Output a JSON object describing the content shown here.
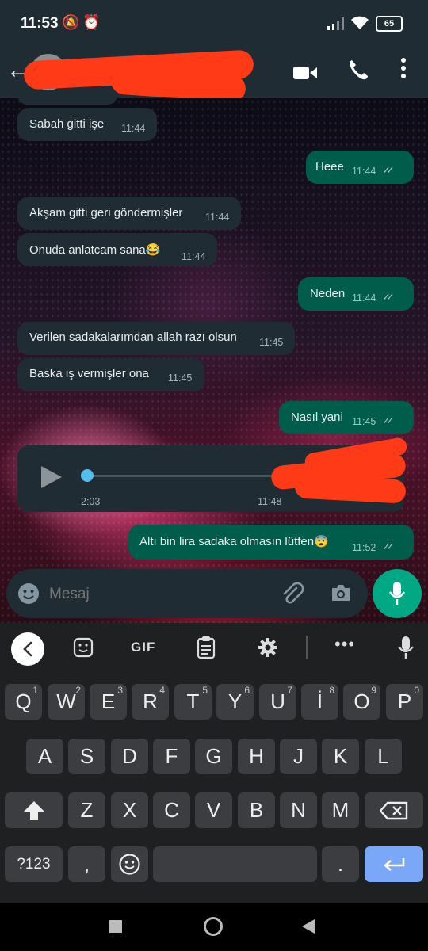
{
  "status_bar": {
    "time": "11:53",
    "battery": "65"
  },
  "header": {
    "contact_name": ""
  },
  "messages": [
    {
      "dir": "in",
      "text": "Sabah gitti işe",
      "time": "11:44"
    },
    {
      "dir": "out",
      "text": "Heee",
      "time": "11:44"
    },
    {
      "dir": "in",
      "text": "Akşam gitti geri göndermişler",
      "time": "11:44"
    },
    {
      "dir": "in",
      "text": "Onuda anlatcam sana😂",
      "time": "11:44"
    },
    {
      "dir": "out",
      "text": "Neden",
      "time": "11:44"
    },
    {
      "dir": "in",
      "text": "Verilen sadakalarımdan allah razı olsun",
      "time": "11:45"
    },
    {
      "dir": "in",
      "text": "Baska iş vermişler ona",
      "time": "11:45"
    },
    {
      "dir": "out",
      "text": "Nasıl yani",
      "time": "11:45"
    },
    {
      "dir": "out",
      "text": "Altı bin lira sadaka olmasın lütfen😨",
      "time": "11:52"
    }
  ],
  "voice_note": {
    "duration": "2:03",
    "time": "11:48",
    "progress": 0.0
  },
  "composer": {
    "placeholder": "Mesaj"
  },
  "keyboard": {
    "toolbar": {
      "gif": "GIF"
    },
    "row1": [
      {
        "k": "Q",
        "n": "1"
      },
      {
        "k": "W",
        "n": "2"
      },
      {
        "k": "E",
        "n": "3"
      },
      {
        "k": "R",
        "n": "4"
      },
      {
        "k": "T",
        "n": "5"
      },
      {
        "k": "Y",
        "n": "6"
      },
      {
        "k": "U",
        "n": "7"
      },
      {
        "k": "İ",
        "n": "8"
      },
      {
        "k": "O",
        "n": "9"
      },
      {
        "k": "P",
        "n": "0"
      }
    ],
    "row2": [
      "A",
      "S",
      "D",
      "F",
      "G",
      "H",
      "J",
      "K",
      "L"
    ],
    "row3": [
      "Z",
      "X",
      "C",
      "V",
      "B",
      "N",
      "M"
    ],
    "symbols": "?123",
    "comma": ",",
    "period": "."
  },
  "colors": {
    "accent": "#00a884",
    "incoming_bubble": "#1f2c33",
    "outgoing_bubble": "#005c4b",
    "enter_key": "#7aa7f7"
  }
}
